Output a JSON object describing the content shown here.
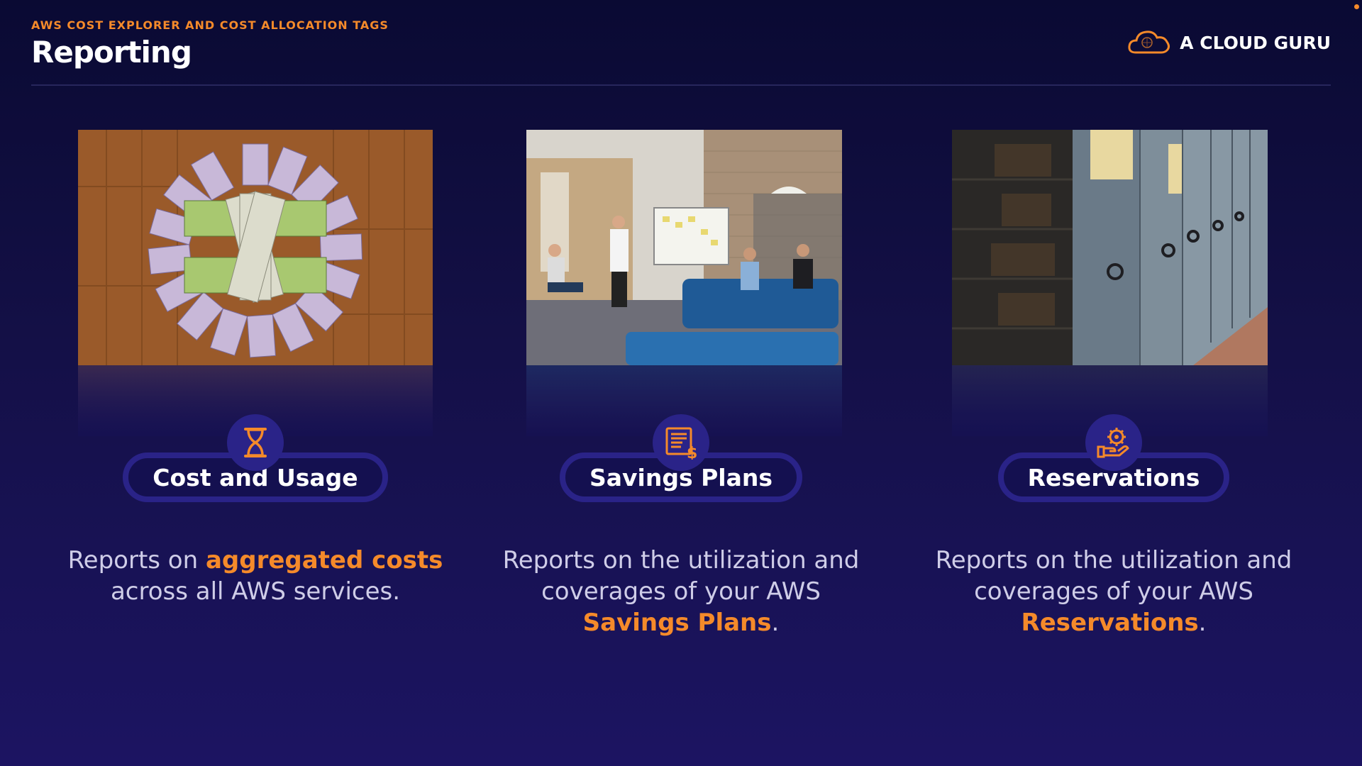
{
  "header": {
    "kicker": "AWS COST EXPLORER AND COST ALLOCATION TAGS",
    "title": "Reporting"
  },
  "brand": {
    "name": "A CLOUD GURU",
    "icon": "cloud-logo-icon"
  },
  "colors": {
    "accent": "#f58a2a",
    "pill_border": "#2a2388",
    "background": "#141047"
  },
  "cards": [
    {
      "image": "money-circle-photo",
      "icon": "hourglass-icon",
      "label": "Cost and Usage",
      "desc_pre": "Reports on ",
      "desc_hl": "aggregated costs",
      "desc_post": " across all AWS services."
    },
    {
      "image": "team-meeting-photo",
      "icon": "invoice-dollar-icon",
      "label": "Savings Plans",
      "desc_pre": "Reports on the utilization and coverages of your AWS ",
      "desc_hl": "Savings Plans",
      "desc_post": "."
    },
    {
      "image": "archive-shelves-photo",
      "icon": "hand-gear-icon",
      "label": "Reservations",
      "desc_pre": "Reports on the utilization and coverages of your AWS ",
      "desc_hl": "Reservations",
      "desc_post": "."
    }
  ]
}
